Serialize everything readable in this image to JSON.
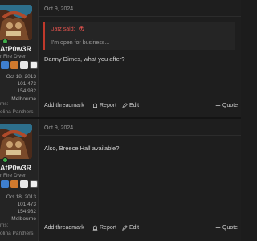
{
  "posts": [
    {
      "date": "Oct 9, 2024",
      "username": "AtP0w3R",
      "user_title": "r Fire Diver",
      "joined": "Oct 18, 2013",
      "messages": "101,473",
      "reactions": "154,982",
      "location": "Melbourne",
      "fav_label": "ms:",
      "fav_team": "olina Panthers",
      "quote": {
        "author": "Jatz said:",
        "text": "I'm open for business..."
      },
      "body": "Danny Dimes, what you after?",
      "actions": {
        "threadmark": "Add threadmark",
        "report": "Report",
        "edit": "Edit",
        "quote": "Quote"
      }
    },
    {
      "date": "Oct 9, 2024",
      "username": "AtP0w3R",
      "user_title": "r Fire Diver",
      "joined": "Oct 18, 2013",
      "messages": "101,473",
      "reactions": "154,982",
      "location": "Melbourne",
      "fav_label": "ms:",
      "fav_team": "olina Panthers",
      "body": "Also, Breece Hall available?",
      "actions": {
        "threadmark": "Add threadmark",
        "report": "Report",
        "edit": "Edit",
        "quote": "Quote"
      }
    }
  ],
  "colors": {
    "online": "#3fae49",
    "quote_accent": "#c0392b",
    "background": "#1c1c1c"
  },
  "icons": [
    "online-status-icon",
    "quote-arrow-icon",
    "report-icon",
    "edit-icon",
    "plus-icon"
  ]
}
